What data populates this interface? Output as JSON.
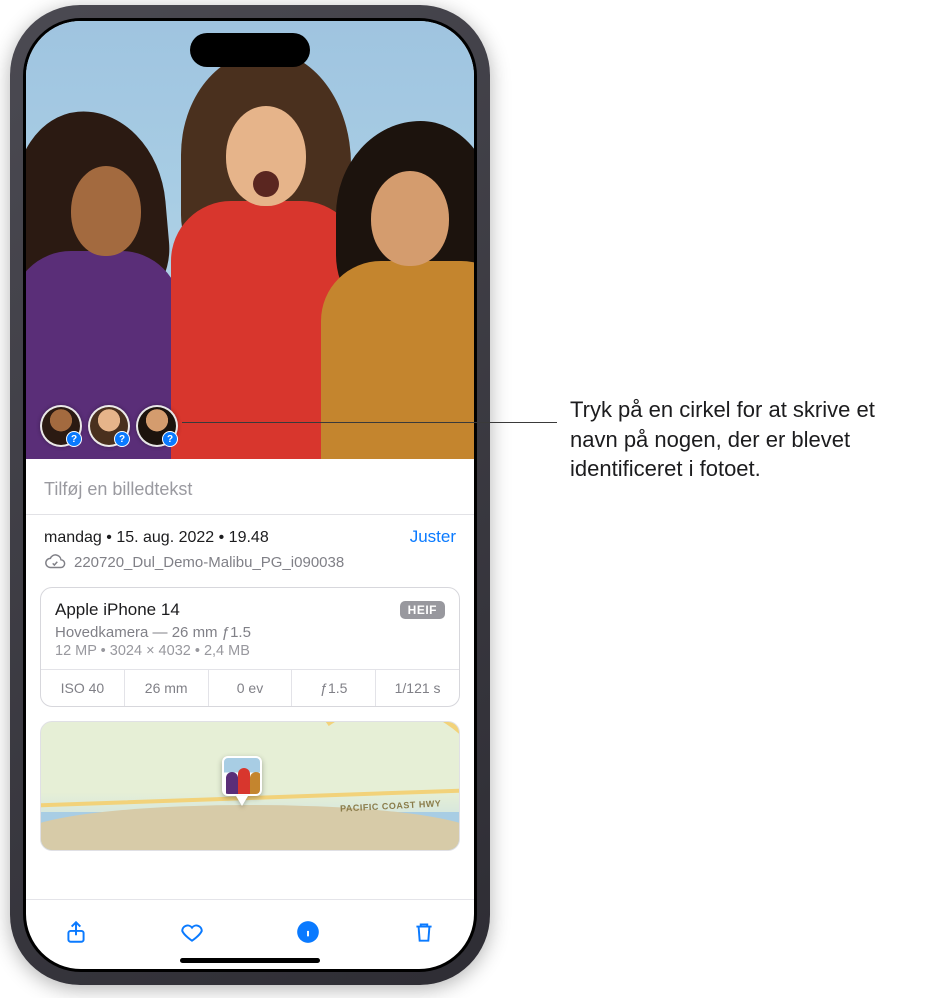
{
  "photo": {
    "caption_placeholder": "Tilføj en billedtekst",
    "people_detected": [
      {
        "name": "person-1",
        "badge": "?"
      },
      {
        "name": "person-2",
        "badge": "?"
      },
      {
        "name": "person-3",
        "badge": "?"
      }
    ]
  },
  "date": {
    "full": "mandag • 15. aug. 2022 • 19.48",
    "adjust_label": "Juster",
    "filename": "220720_Dul_Demo-Malibu_PG_i090038"
  },
  "camera": {
    "device": "Apple iPhone 14",
    "format_badge": "HEIF",
    "lens": "Hovedkamera — 26 mm ƒ1.5",
    "meta": "12 MP • 3024 × 4032 • 2,4 MB",
    "specs": {
      "iso": "ISO 40",
      "focal": "26 mm",
      "ev": "0 ev",
      "aperture": "ƒ1.5",
      "shutter": "1/121 s"
    }
  },
  "map": {
    "road_label": "PACIFIC COAST HWY"
  },
  "toolbar": {
    "share": "share-icon",
    "favorite": "favorite-icon",
    "info": "info-icon",
    "delete": "trash-icon"
  },
  "callout": {
    "text": "Tryk på en cirkel for at skrive et navn på nogen, der er blevet identificeret i fotoet."
  }
}
